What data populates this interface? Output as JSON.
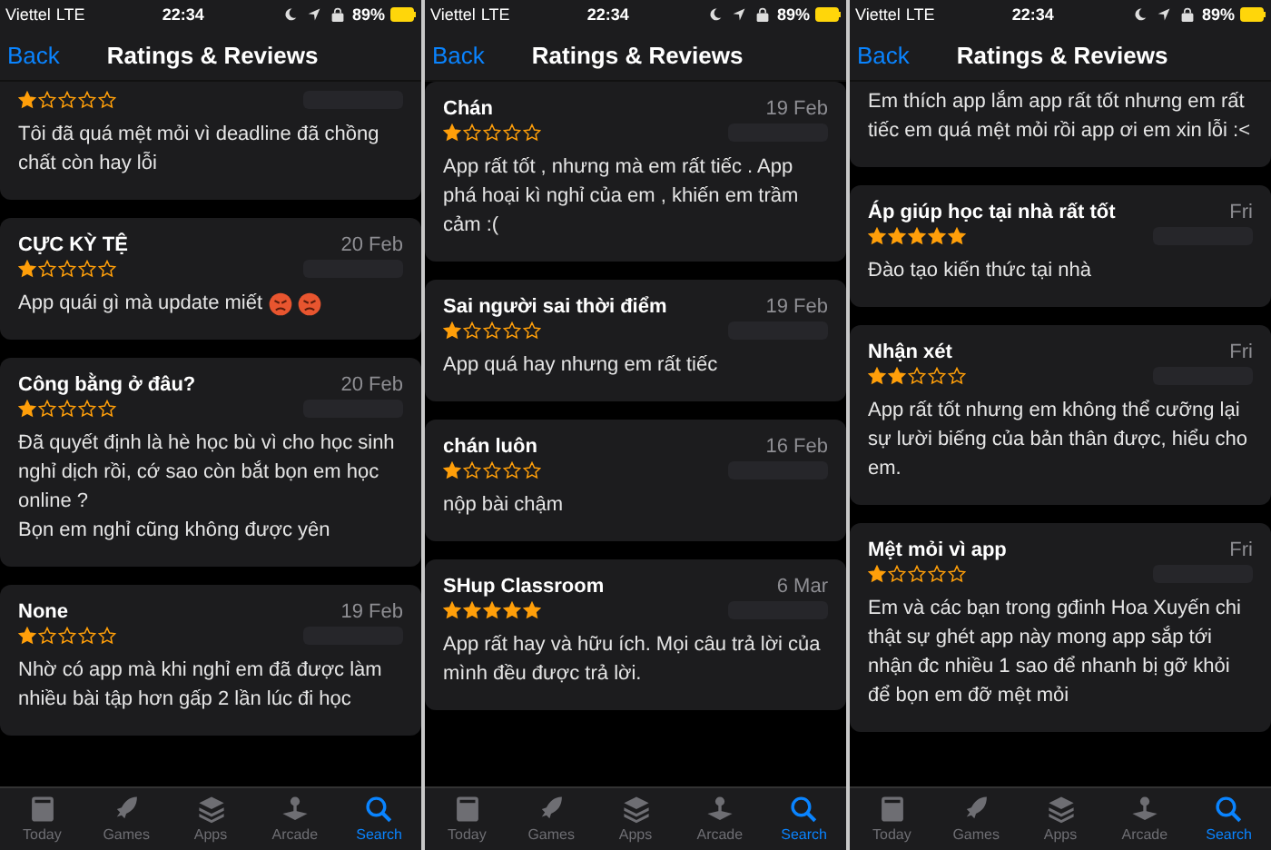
{
  "screens": [
    {
      "status_bar": {
        "carrier": "Viettel",
        "network": "LTE",
        "time": "22:34",
        "battery": "89%"
      },
      "nav": {
        "back": "Back",
        "title": "Ratings & Reviews"
      },
      "reviews": [
        {
          "stars": 1,
          "body": "Tôi đã quá mệt mỏi vì deadline đã chồng chất còn hay lỗi"
        },
        {
          "title": "CỰC KỲ TỆ",
          "date": "20 Feb",
          "stars": 1,
          "body": "App quái gì mà update miết",
          "reactions": [
            {
              "kind": "angry"
            },
            {
              "kind": "angry"
            }
          ]
        },
        {
          "title": "Công bằng ở đâu?",
          "date": "20 Feb",
          "stars": 1,
          "body": "Đã quyết định là hè học bù vì cho học sinh nghỉ dịch rồi, cớ sao còn bắt bọn em học online ?\nBọn em nghỉ cũng không được yên"
        },
        {
          "title": "None",
          "date": "19 Feb",
          "stars": 1,
          "body": "Nhờ có app mà khi nghỉ em đã được làm nhiều bài tập hơn gấp 2 lần lúc đi học"
        }
      ],
      "tabs": [
        {
          "label": "Today",
          "selected": false
        },
        {
          "label": "Games",
          "selected": false
        },
        {
          "label": "Apps",
          "selected": false
        },
        {
          "label": "Arcade",
          "selected": false
        },
        {
          "label": "Search",
          "selected": true
        }
      ]
    },
    {
      "status_bar": {
        "carrier": "Viettel",
        "network": "LTE",
        "time": "22:34",
        "battery": "89%"
      },
      "nav": {
        "back": "Back",
        "title": "Ratings & Reviews"
      },
      "reviews": [
        {
          "title": "Chán",
          "date": "19 Feb",
          "stars": 1,
          "body": "App rất tốt , nhưng mà em rất tiếc . App phá hoại kì nghỉ của em , khiến em trầm cảm :("
        },
        {
          "title": "Sai người sai thời điểm",
          "date": "19 Feb",
          "stars": 1,
          "body": "App quá hay nhưng em rất tiếc"
        },
        {
          "title": "chán luôn",
          "date": "16 Feb",
          "stars": 1,
          "body": "nộp bài chậm"
        },
        {
          "title": "SHup Classroom",
          "date": "6 Mar",
          "stars": 5,
          "body": "App rất hay và hữu ích. Mọi câu trả lời của mình đều được trả lời."
        }
      ],
      "tabs": [
        {
          "label": "Today",
          "selected": false
        },
        {
          "label": "Games",
          "selected": false
        },
        {
          "label": "Apps",
          "selected": false
        },
        {
          "label": "Arcade",
          "selected": false
        },
        {
          "label": "Search",
          "selected": true
        }
      ]
    },
    {
      "status_bar": {
        "carrier": "Viettel",
        "network": "LTE",
        "time": "22:34",
        "battery": "89%"
      },
      "nav": {
        "back": "Back",
        "title": "Ratings & Reviews"
      },
      "reviews": [
        {
          "body": "Em thích app lắm app rất tốt nhưng em rất tiếc em quá mệt mỏi rồi app ơi em xin lỗi :<"
        },
        {
          "title": "Áp giúp học tại nhà rất tốt",
          "date": "Fri",
          "stars": 5,
          "body": "Đào tạo kiến thức tại nhà"
        },
        {
          "title": "Nhận xét",
          "date": "Fri",
          "stars": 2,
          "body": "App rất tốt nhưng em không thể cưỡng lại sự lười biếng của bản thân được, hiểu cho em."
        },
        {
          "title": "Mệt mỏi vì app",
          "date": "Fri",
          "stars": 1,
          "body": "Em và các bạn trong gđinh Hoa Xuyến chi thật sự ghét app này mong app sắp tới nhận đc nhiều 1 sao để nhanh bị gỡ khỏi để bọn em đỡ mệt mỏi"
        }
      ],
      "tabs": [
        {
          "label": "Today",
          "selected": false
        },
        {
          "label": "Games",
          "selected": false
        },
        {
          "label": "Apps",
          "selected": false
        },
        {
          "label": "Arcade",
          "selected": false
        },
        {
          "label": "Search",
          "selected": true
        }
      ]
    }
  ]
}
